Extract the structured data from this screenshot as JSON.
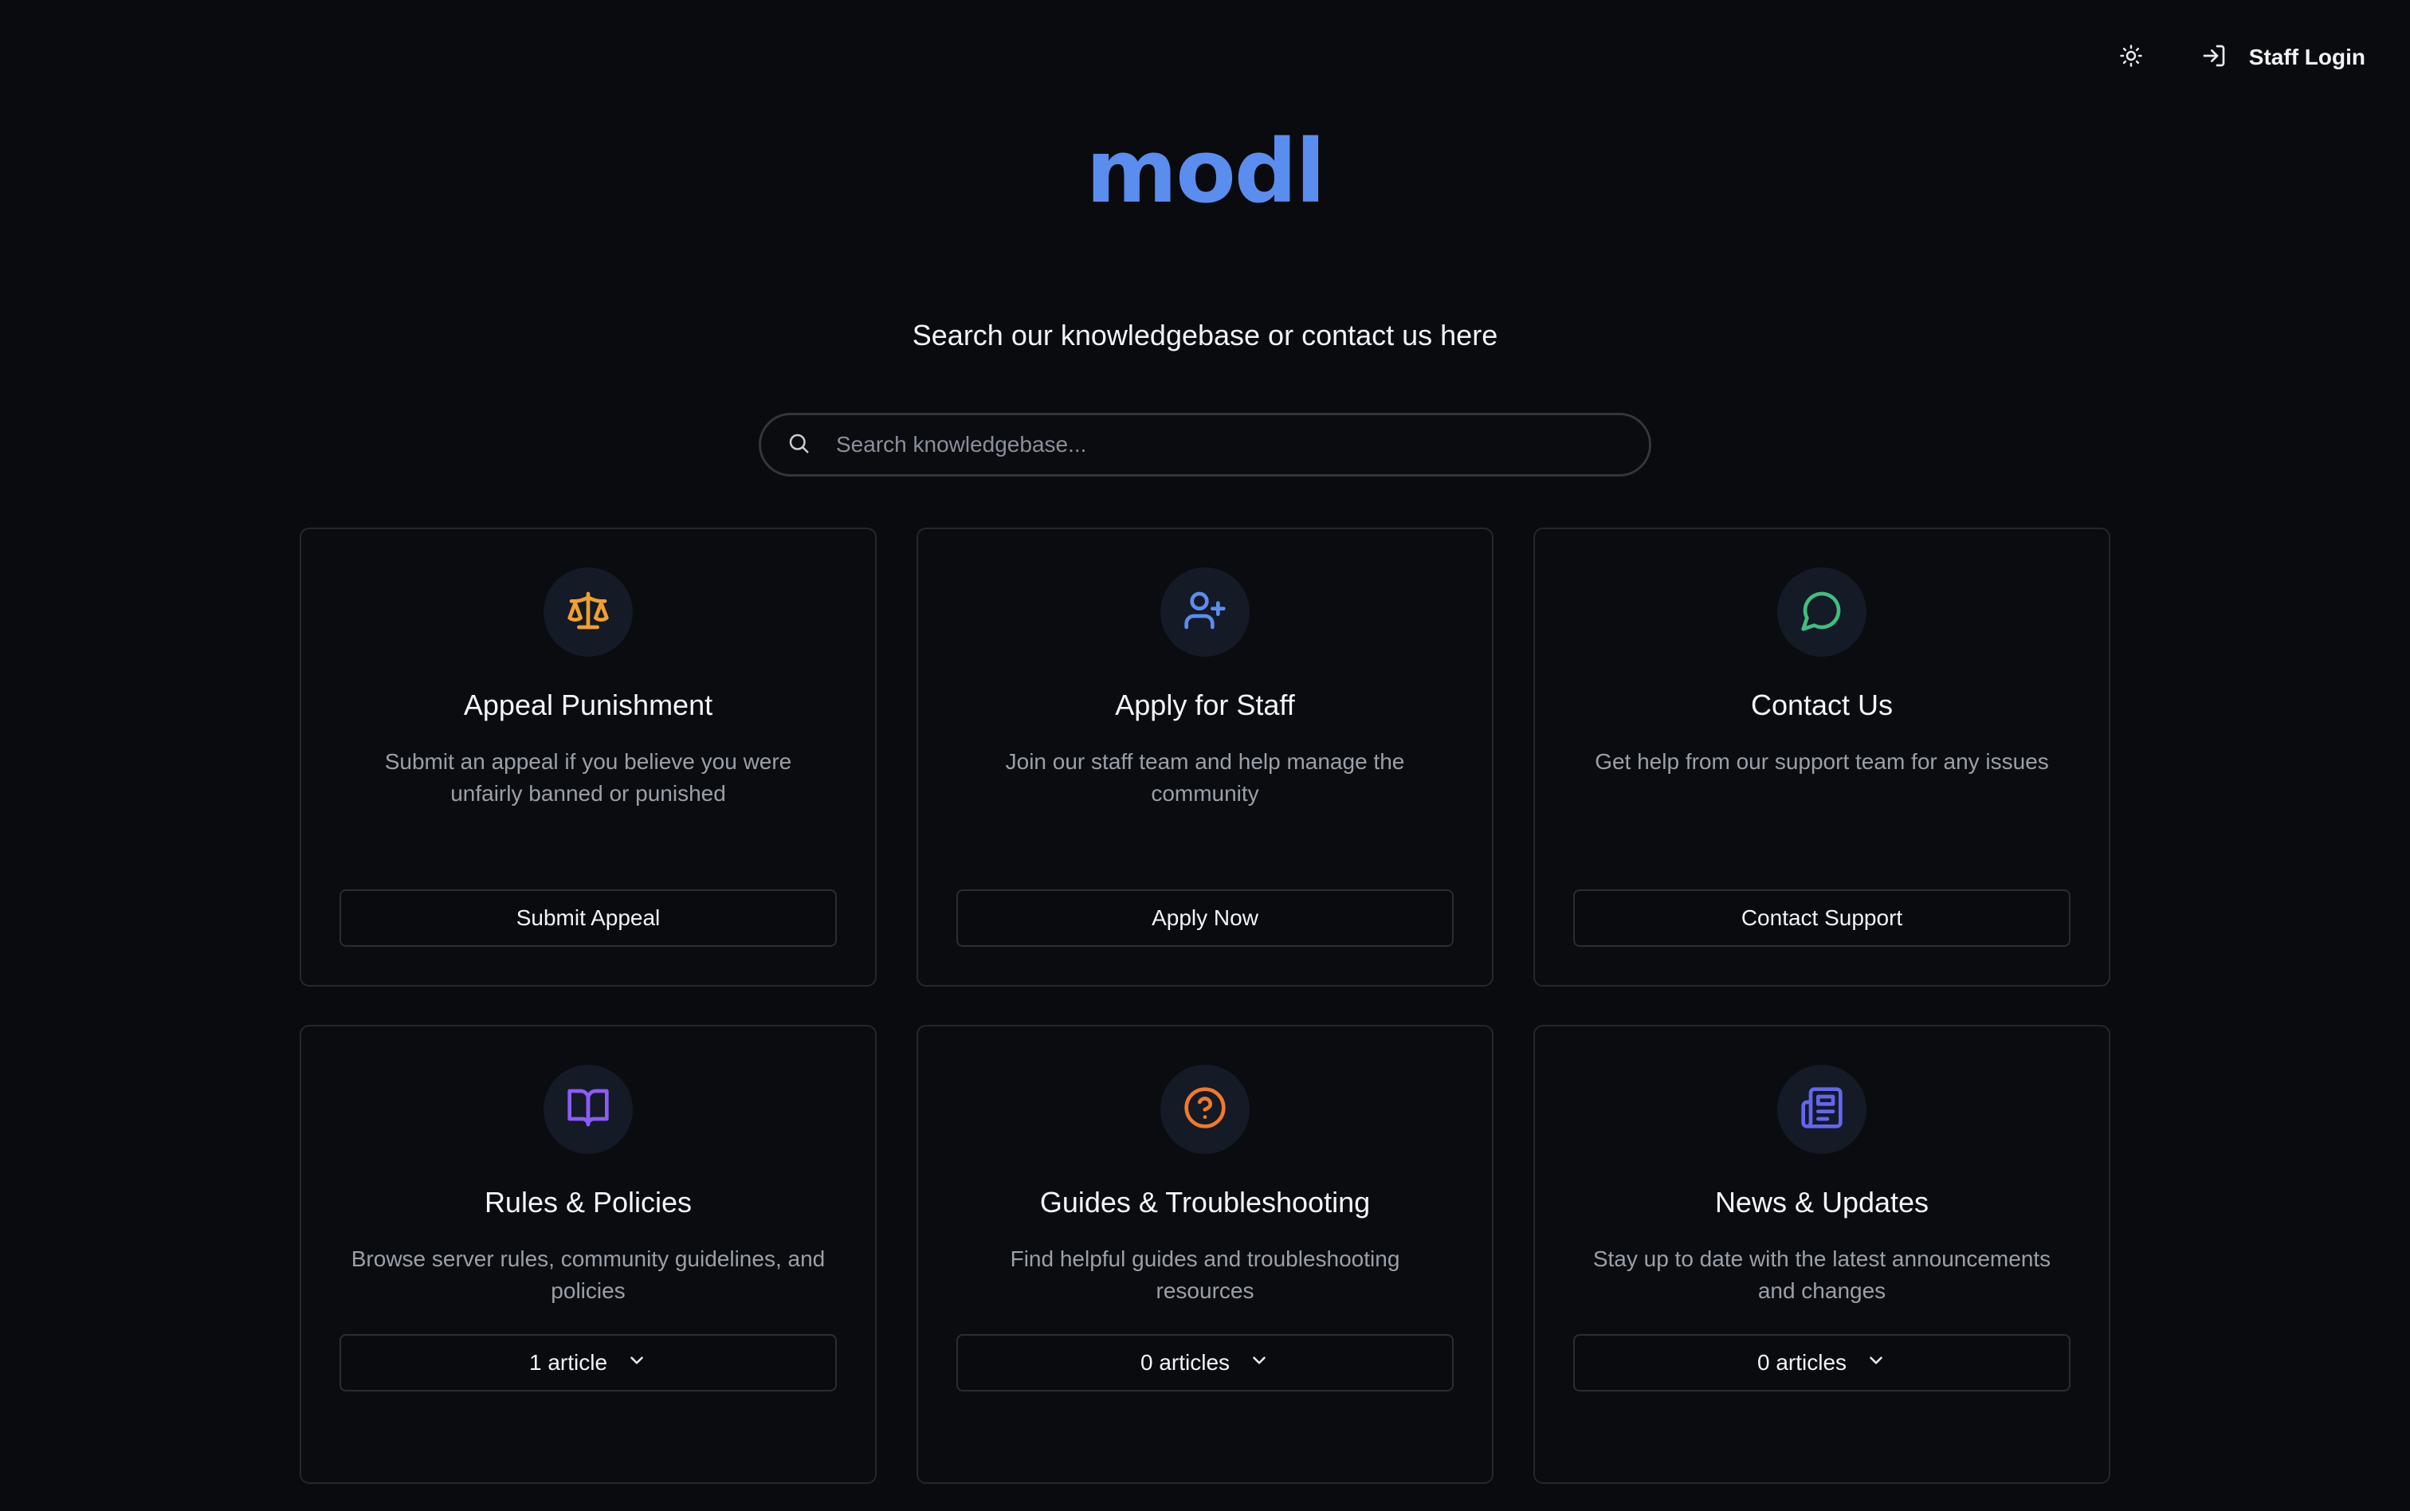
{
  "header": {
    "staff_login_label": "Staff Login"
  },
  "logo": {
    "text": "modl",
    "color": "#5b8def"
  },
  "tagline": "Search our knowledgebase or contact us here",
  "search": {
    "placeholder": "Search knowledgebase..."
  },
  "cards": [
    {
      "title": "Appeal Punishment",
      "description": "Submit an appeal if you believe you were unfairly banned or punished",
      "action": "Submit Appeal",
      "icon": "scale-icon",
      "icon_color": "#f0a030"
    },
    {
      "title": "Apply for Staff",
      "description": "Join our staff team and help manage the community",
      "action": "Apply Now",
      "icon": "user-plus-icon",
      "icon_color": "#5b8def"
    },
    {
      "title": "Contact Us",
      "description": "Get help from our support team for any issues",
      "action": "Contact Support",
      "icon": "chat-bubble-icon",
      "icon_color": "#3fbf7f"
    },
    {
      "title": "Rules & Policies",
      "description": "Browse server rules, community guidelines, and policies",
      "action": "1 article",
      "icon": "book-open-icon",
      "icon_color": "#8b5cf6"
    },
    {
      "title": "Guides & Troubleshooting",
      "description": "Find helpful guides and troubleshooting resources",
      "action": "0 articles",
      "icon": "help-circle-icon",
      "icon_color": "#f07a2a"
    },
    {
      "title": "News & Updates",
      "description": "Stay up to date with the latest announcements and changes",
      "action": "0 articles",
      "icon": "newspaper-icon",
      "icon_color": "#6366f1"
    }
  ]
}
